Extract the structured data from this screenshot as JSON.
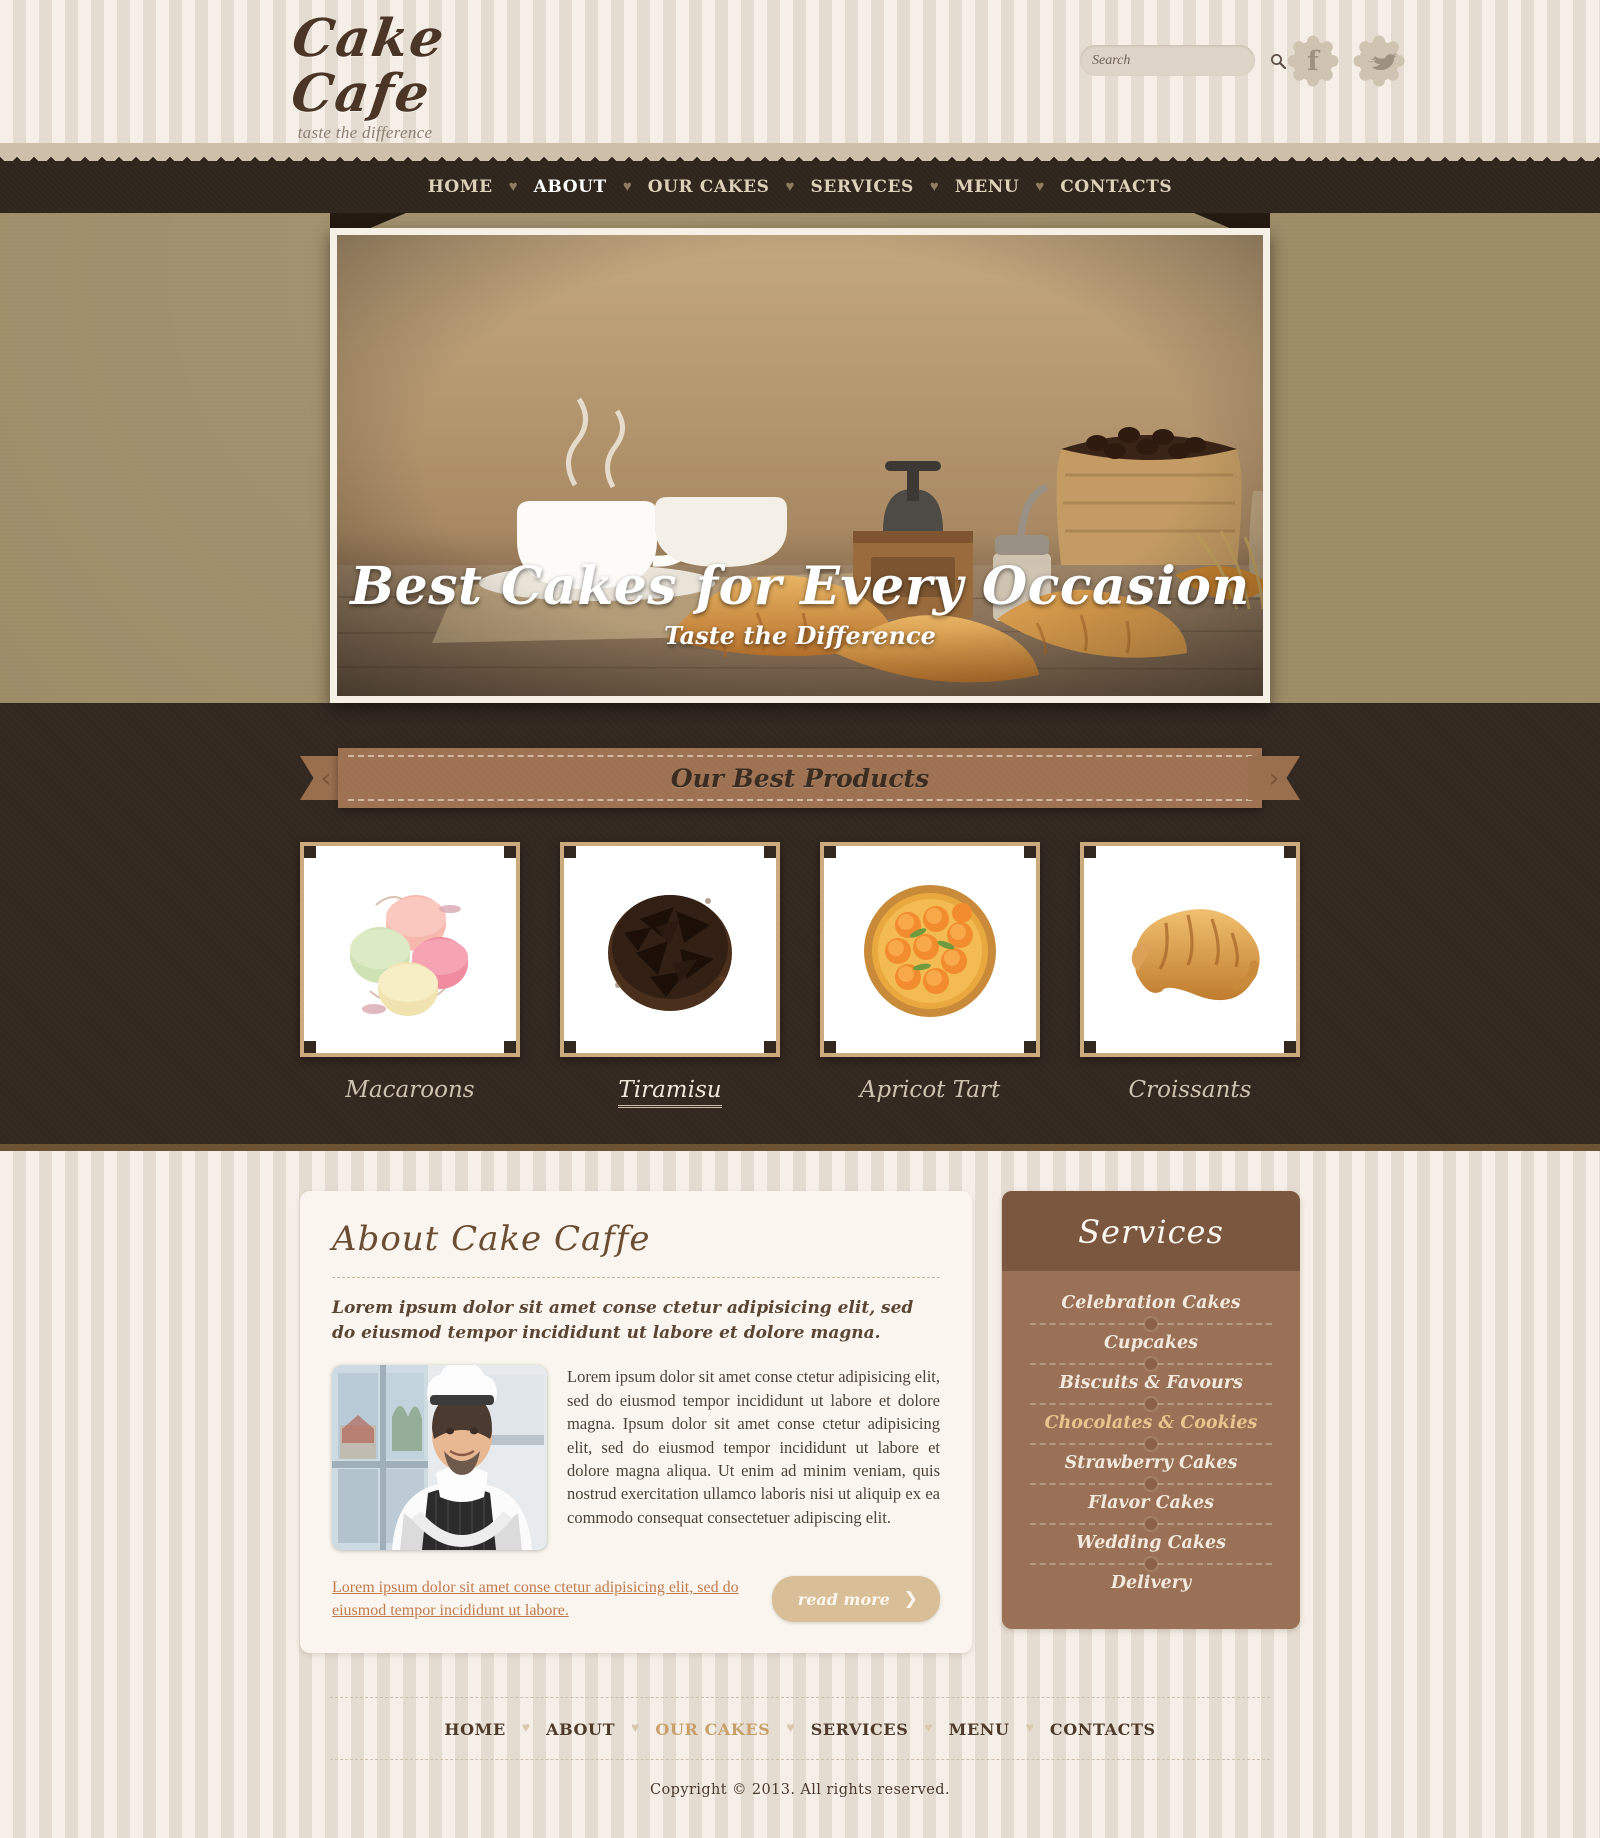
{
  "site": {
    "logo_title": "Cake Cafe",
    "logo_tagline": "taste the difference"
  },
  "search": {
    "placeholder": "Search",
    "value": "",
    "icon": "search-icon"
  },
  "social": [
    {
      "name": "facebook",
      "glyph": "f"
    },
    {
      "name": "twitter",
      "glyph": "❧"
    }
  ],
  "nav": {
    "separator": "♥",
    "items": [
      {
        "label": "HOME",
        "active": false
      },
      {
        "label": "ABOUT",
        "active": true
      },
      {
        "label": "OUR CAKES",
        "active": false
      },
      {
        "label": "SERVICES",
        "active": false
      },
      {
        "label": "MENU",
        "active": false
      },
      {
        "label": "CONTACTS",
        "active": false
      }
    ]
  },
  "hero": {
    "headline": "Best Cakes for Every Occasion",
    "subhead": "Taste the Difference"
  },
  "products": {
    "ribbon_title": "Our Best Products",
    "prev_arrow": "‹",
    "next_arrow": "›",
    "items": [
      {
        "label": "Macaroons",
        "hover": false
      },
      {
        "label": "Tiramisu",
        "hover": true
      },
      {
        "label": "Apricot Tart",
        "hover": false
      },
      {
        "label": "Croissants",
        "hover": false
      }
    ]
  },
  "about": {
    "heading": "About Cake Caffe",
    "lead": "Lorem ipsum dolor sit amet conse ctetur adipisicing elit, sed do eiusmod tempor incididunt ut labore et dolore magna.",
    "body": "Lorem ipsum dolor sit amet conse ctetur adipisicing elit, sed do eiusmod tempor incididunt ut labore et dolore magna. Ipsum dolor sit amet conse ctetur adipisicing elit, sed do eiusmod tempor incididunt ut labore et dolore magna aliqua. Ut enim ad minim veniam, quis nostrud exercitation ullamco laboris nisi ut aliquip ex ea commodo consequat consectetuer adipiscing elit.",
    "link_text": "Lorem ipsum dolor sit amet conse ctetur adipisicing elit, sed do eiusmod tempor incididunt ut labore.",
    "read_more_label": "read more",
    "read_more_chevron": "❯",
    "image_alt": "chef-photo"
  },
  "services": {
    "heading": "Services",
    "items": [
      {
        "label": "Celebration Cakes",
        "active": false
      },
      {
        "label": "Cupcakes",
        "active": false
      },
      {
        "label": "Biscuits & Favours",
        "active": false
      },
      {
        "label": "Chocolates & Cookies",
        "active": true
      },
      {
        "label": "Strawberry Cakes",
        "active": false
      },
      {
        "label": "Flavor Cakes",
        "active": false
      },
      {
        "label": "Wedding Cakes",
        "active": false
      },
      {
        "label": "Delivery",
        "active": false
      }
    ]
  },
  "footer": {
    "separator": "♥",
    "items": [
      {
        "label": "HOME",
        "active": false
      },
      {
        "label": "ABOUT",
        "active": false
      },
      {
        "label": "OUR CAKES",
        "active": true
      },
      {
        "label": "SERVICES",
        "active": false
      },
      {
        "label": "MENU",
        "active": false
      },
      {
        "label": "CONTACTS",
        "active": false
      }
    ],
    "copyright": "Copyright © 2013. All rights reserved."
  },
  "colors": {
    "dark_brown": "#2f251d",
    "mid_brown": "#9a7156",
    "tan": "#cbab7b",
    "accent_gold": "#e8c58e",
    "link_orange": "#c07a4e",
    "cream": "#faf6ef"
  }
}
